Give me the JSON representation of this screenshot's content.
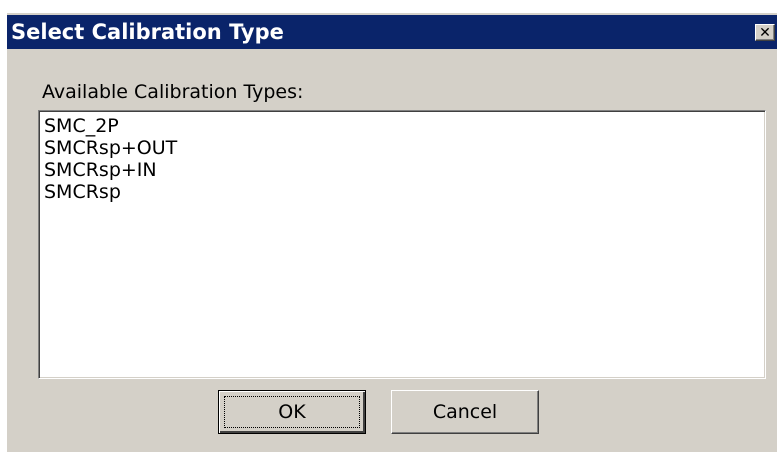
{
  "window": {
    "title": "Select Calibration Type",
    "close_icon": "close-icon",
    "close_glyph": "✕"
  },
  "dialog": {
    "list_label": "Available Calibration Types:",
    "items": [
      "SMC_2P",
      "SMCRsp+OUT",
      "SMCRsp+IN",
      "SMCRsp"
    ],
    "ok_label": "OK",
    "cancel_label": "Cancel"
  },
  "colors": {
    "titlebar": "#0a246a",
    "face": "#d4d0c8",
    "list_background": "#ffffff"
  }
}
